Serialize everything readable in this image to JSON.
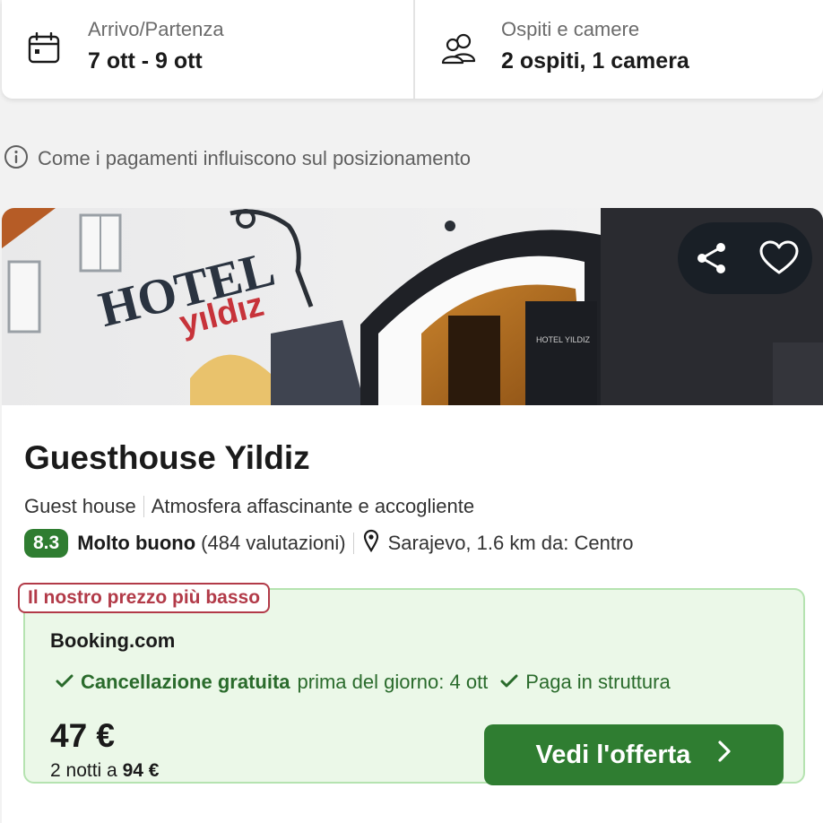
{
  "search": {
    "dates_label": "Arrivo/Partenza",
    "dates_value": "7 ott - 9 ott",
    "guests_label": "Ospiti e camere",
    "guests_value": "2 ospiti, 1 camera"
  },
  "info": {
    "text": "Come i pagamenti influiscono sul posizionamento"
  },
  "hotel": {
    "name": "Guesthouse Yildiz",
    "type": "Guest house",
    "tagline": "Atmosfera affascinante e accogliente",
    "score": "8.3",
    "rating_word": "Molto buono",
    "reviews": "(484 valutazioni)",
    "location": "Sarajevo, 1.6 km da: Centro",
    "image_sign_line1": "HOTEL",
    "image_sign_line2": "yıldız",
    "image_plaque": "HOTEL YILDIZ"
  },
  "offer": {
    "badge": "Il nostro prezzo più basso",
    "provider": "Booking.com",
    "perk1_bold": "Cancellazione gratuita",
    "perk1_rest": "prima del giorno: 4 ott",
    "perk2": "Paga in struttura",
    "price": "47 €",
    "total_prefix": "2 notti a",
    "total_value": "94 €",
    "cta_label": "Vedi l'offerta"
  },
  "colors": {
    "accent_green": "#2f7d31",
    "badge_red": "#b23a48",
    "offer_bg": "#ebf8e8"
  },
  "icons": {
    "dates": "calendar-icon",
    "guests": "people-icon",
    "info": "info-icon",
    "share": "share-icon",
    "favorite": "heart-icon",
    "location": "pin-icon",
    "check": "check-icon",
    "cta": "chevron-right-icon"
  }
}
